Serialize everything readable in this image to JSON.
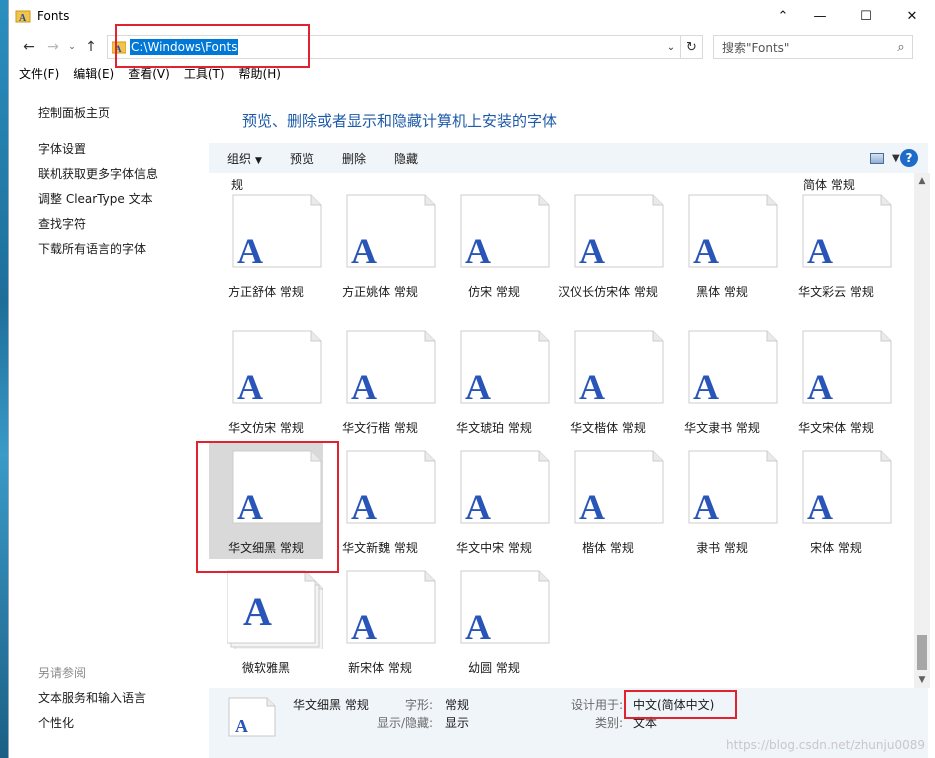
{
  "window": {
    "title": "Fonts",
    "controls": {
      "minimize": "—",
      "maximize": "☐",
      "close": "✕"
    }
  },
  "nav": {
    "back": "←",
    "forward": "→",
    "recent": "⌄",
    "up": "↑"
  },
  "address": {
    "path": "C:\\Windows\\Fonts",
    "dropdown": "⌄",
    "refresh": "↻"
  },
  "search": {
    "placeholder": "搜索\"Fonts\"",
    "icon": "⌕"
  },
  "menu": [
    "文件(F)",
    "编辑(E)",
    "查看(V)",
    "工具(T)",
    "帮助(H)"
  ],
  "left_pane": {
    "home": "控制面板主页",
    "links": [
      "字体设置",
      "联机获取更多字体信息",
      "调整 ClearType 文本",
      "查找字符",
      "下载所有语言的字体"
    ],
    "see_also_heading": "另请参阅",
    "see_also": [
      "文本服务和输入语言",
      "个性化"
    ]
  },
  "content": {
    "title": "预览、删除或者显示和隐藏计算机上安装的字体",
    "commands": {
      "organize": "组织",
      "preview": "预览",
      "delete": "删除",
      "hide": "隐藏"
    },
    "help": "?",
    "partial_labels": [
      "规",
      "简体 常规"
    ]
  },
  "fonts": [
    {
      "name": "方正舒体 常规"
    },
    {
      "name": "方正姚体 常规"
    },
    {
      "name": "仿宋 常规"
    },
    {
      "name": "汉仪长仿宋体 常规"
    },
    {
      "name": "黑体 常规"
    },
    {
      "name": "华文彩云 常规"
    },
    {
      "name": "华文仿宋 常规"
    },
    {
      "name": "华文行楷 常规"
    },
    {
      "name": "华文琥珀 常规"
    },
    {
      "name": "华文楷体 常规"
    },
    {
      "name": "华文隶书 常规"
    },
    {
      "name": "华文宋体 常规"
    },
    {
      "name": "华文细黑 常规",
      "selected": true
    },
    {
      "name": "华文新魏 常规"
    },
    {
      "name": "华文中宋 常规"
    },
    {
      "name": "楷体 常规"
    },
    {
      "name": "隶书 常规"
    },
    {
      "name": "宋体 常规"
    },
    {
      "name": "微软雅黑",
      "family": true
    },
    {
      "name": "新宋体 常规"
    },
    {
      "name": "幼圆 常规"
    }
  ],
  "details": {
    "name": "华文细黑 常规",
    "style_key": "字形:",
    "style_val": "常规",
    "show_key": "显示/隐藏:",
    "show_val": "显示",
    "designed_key": "设计用于:",
    "designed_val": "中文(简体中文)",
    "category_key": "类别:",
    "category_val": "文本"
  },
  "watermark": "https://blog.csdn.net/zhunju0089",
  "colors": {
    "accent": "#0078d7",
    "title_blue": "#1e5aa8",
    "highlight_red": "#e0232e",
    "pane_bg": "#f0f5fa"
  }
}
